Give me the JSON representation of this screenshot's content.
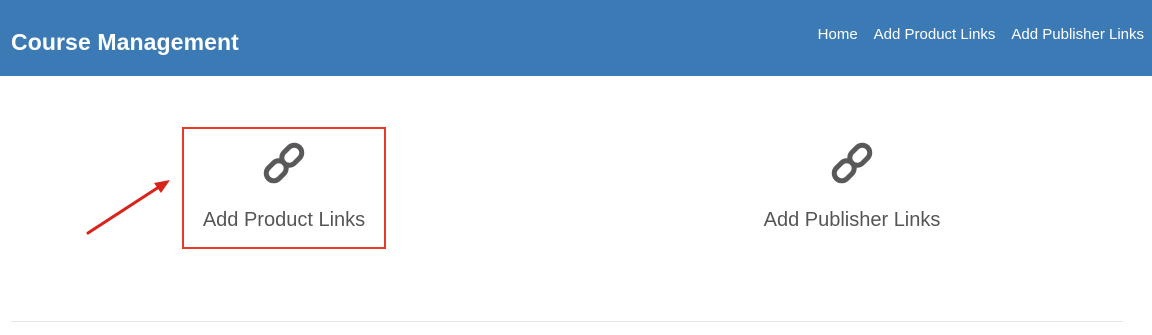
{
  "header": {
    "brand": "Course Management",
    "bg_color": "#3b7ab5",
    "nav": [
      {
        "label": "Home"
      },
      {
        "label": "Add Product Links"
      },
      {
        "label": "Add Publisher Links"
      }
    ]
  },
  "cards": [
    {
      "label": "Add Product Links",
      "icon": "link-icon",
      "highlighted": true,
      "highlight_color": "#e8392b"
    },
    {
      "label": "Add Publisher Links",
      "icon": "link-icon",
      "highlighted": false
    }
  ],
  "annotation": {
    "icon": "arrow-icon",
    "color": "#d8231b"
  }
}
